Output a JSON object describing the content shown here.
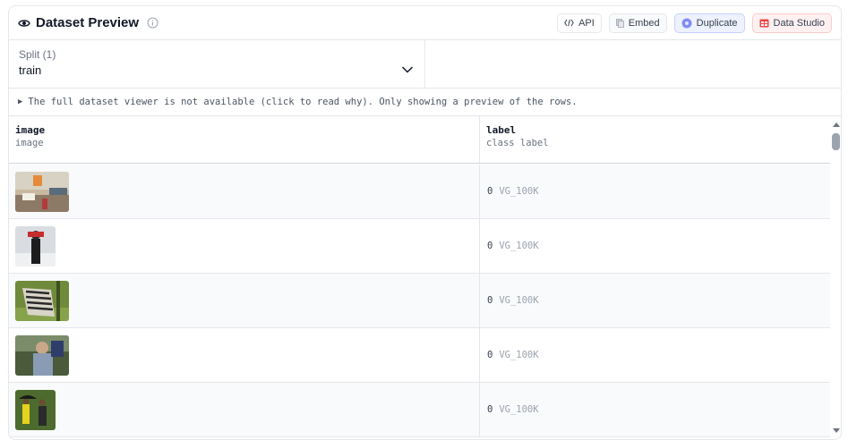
{
  "header": {
    "title": "Dataset Preview",
    "buttons": {
      "api": "API",
      "embed": "Embed",
      "duplicate": "Duplicate",
      "studio": "Data Studio"
    }
  },
  "split": {
    "label": "Split (1)",
    "value": "train"
  },
  "notice": "The full dataset viewer is not available (click to read why). Only showing a preview of the rows.",
  "table": {
    "columns": [
      {
        "name": "image",
        "type": "image"
      },
      {
        "name": "label",
        "type": "class label"
      }
    ],
    "rows": [
      {
        "label_value": "0",
        "label_class": "VG_100K",
        "thumb": "office-room-photo"
      },
      {
        "label_value": "0",
        "label_class": "VG_100K",
        "thumb": "person-in-snow-photo"
      },
      {
        "label_value": "0",
        "label_class": "VG_100K",
        "thumb": "zebra-grazing-photo"
      },
      {
        "label_value": "0",
        "label_class": "VG_100K",
        "thumb": "man-outdoors-photo"
      },
      {
        "label_value": "0",
        "label_class": "VG_100K",
        "thumb": "people-with-umbrella-photo"
      }
    ]
  },
  "colors": {
    "border": "#e5e7eb",
    "duplicate_accent": "#6366f1",
    "studio_accent": "#dc2626"
  }
}
